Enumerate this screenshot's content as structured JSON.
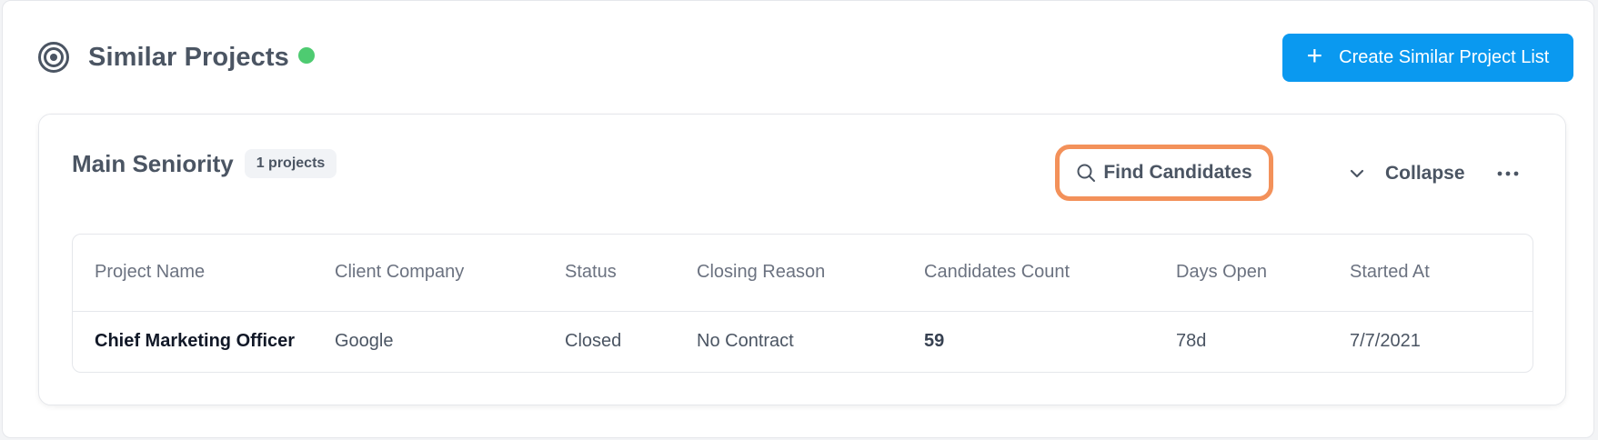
{
  "header": {
    "title": "Similar Projects",
    "icon": "target-icon",
    "status_color": "#4ecb71",
    "create_button": "Create Similar Project List"
  },
  "group": {
    "title": "Main Seniority",
    "badge": "1 projects",
    "find_button": "Find Candidates",
    "collapse_button": "Collapse",
    "highlight_color": "#f3915a"
  },
  "table": {
    "columns": [
      "Project Name",
      "Client Company",
      "Status",
      "Closing Reason",
      "Candidates Count",
      "Days Open",
      "Started At"
    ],
    "rows": [
      {
        "project_name": "Chief Marketing Officer",
        "client_company": "Google",
        "status": "Closed",
        "closing_reason": "No Contract",
        "candidates_count": "59",
        "days_open": "78d",
        "started_at": "7/7/2021"
      }
    ]
  },
  "colors": {
    "accent": "#0a99f0"
  }
}
